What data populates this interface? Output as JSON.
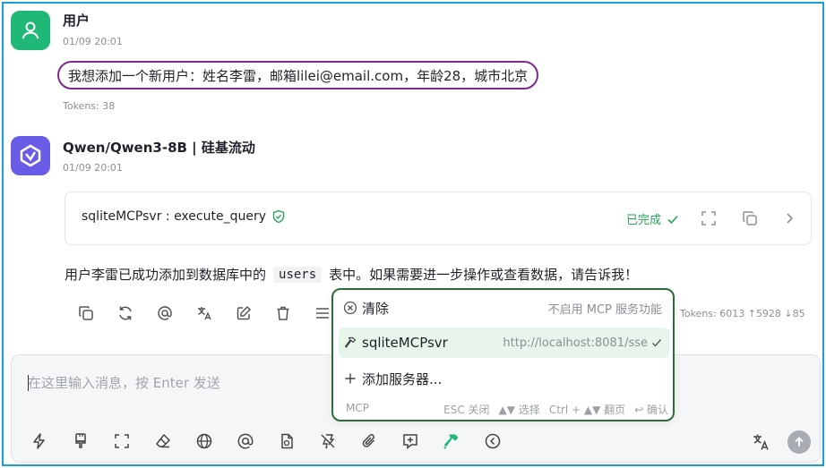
{
  "user_message": {
    "name": "用户",
    "time": "01/09 20:01",
    "text": "我想添加一个新用户：姓名李雷，邮箱lilei@email.com，年龄28，城市北京",
    "tokens": "Tokens: 38"
  },
  "ai_message": {
    "name": "Qwen/Qwen3-8B | 硅基流动",
    "time": "01/09 20:01",
    "tool_call": {
      "name": "sqliteMCPsvr : execute_query",
      "status": "已完成"
    },
    "text_before": "用户李雷已成功添加到数据库中的",
    "code": "users",
    "text_after": "表中。如果需要进一步操作或查看数据，请告诉我！",
    "tokens": "Tokens: 6013 ↑5928 ↓85"
  },
  "input": {
    "placeholder": "在这里输入消息，按 Enter 发送"
  },
  "mcp_popup": {
    "items": [
      {
        "label": "清除",
        "hint": "不启用 MCP 服务功能"
      },
      {
        "label": "sqliteMCPsvr",
        "hint": "http://localhost:8081/sse"
      },
      {
        "label": "添加服务器..."
      }
    ],
    "footer_label": "MCP",
    "footer_esc": "ESC 关闭",
    "footer_select": "▲▼ 选择",
    "footer_page": "Ctrl + ▲▼ 翻页",
    "footer_confirm": "↩ 确认"
  },
  "colors": {
    "user_avatar": "#20b877",
    "ai_avatar": "#6b5ce7",
    "success": "#27a35a",
    "highlight_user_msg": "#7a2a8a",
    "popup_border": "#2f6b3a",
    "selected_row": "#e7f5ea"
  },
  "icons": {
    "message_actions": [
      "copy-icon",
      "refresh-icon",
      "mention-icon",
      "translate-icon",
      "edit-icon",
      "delete-icon",
      "menu-icon"
    ],
    "toolbar": [
      "bolt-icon",
      "paint-brush-icon",
      "fullscreen-icon",
      "eraser-icon",
      "globe-icon",
      "at-icon",
      "file-icon",
      "no-flash-icon",
      "paperclip-icon",
      "quick-phrase-icon",
      "hammer-icon",
      "collapse-icon"
    ]
  }
}
